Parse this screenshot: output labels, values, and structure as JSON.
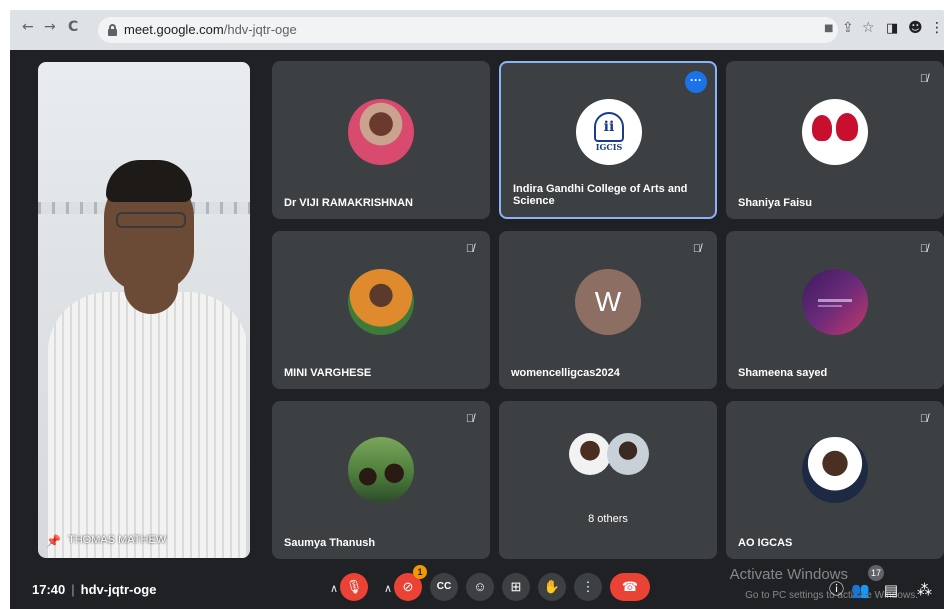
{
  "browser": {
    "back": "←",
    "forward": "→",
    "reload": "C",
    "url_host": "meet.google.com",
    "url_path": "/hdv-jqtr-oge"
  },
  "participants": [
    {
      "name": "Dr VIJI RAMAKRISHNAN",
      "muted": false
    },
    {
      "name": "Indira Gandhi College of Arts and Science",
      "muted": false,
      "logo_text": "IGCIS"
    },
    {
      "name": "Shaniya Faisu",
      "muted": true
    },
    {
      "name": "MINI VARGHESE",
      "muted": true
    },
    {
      "name": "womencelligcas2024",
      "muted": true,
      "initial": "W"
    },
    {
      "name": "Shameena sayed",
      "muted": true
    },
    {
      "name": "Saumya Thanush",
      "muted": true
    },
    {
      "name": "8 others",
      "muted": false
    },
    {
      "name": "AO IGCAS",
      "muted": true
    }
  ],
  "main_video": {
    "name": "THOMAS MATHEW"
  },
  "bottom_bar": {
    "time": "17:40",
    "meeting_code": "hdv-jqtr-oge",
    "badge_count": "1",
    "people_count": "17"
  },
  "watermark": {
    "line1": "Activate Windows",
    "line2": "Go to PC settings to activate Windows."
  },
  "colors": {
    "accent": "#1a73e8",
    "hangup": "#ea4335",
    "tile": "#3c4043",
    "bg": "#202124"
  }
}
